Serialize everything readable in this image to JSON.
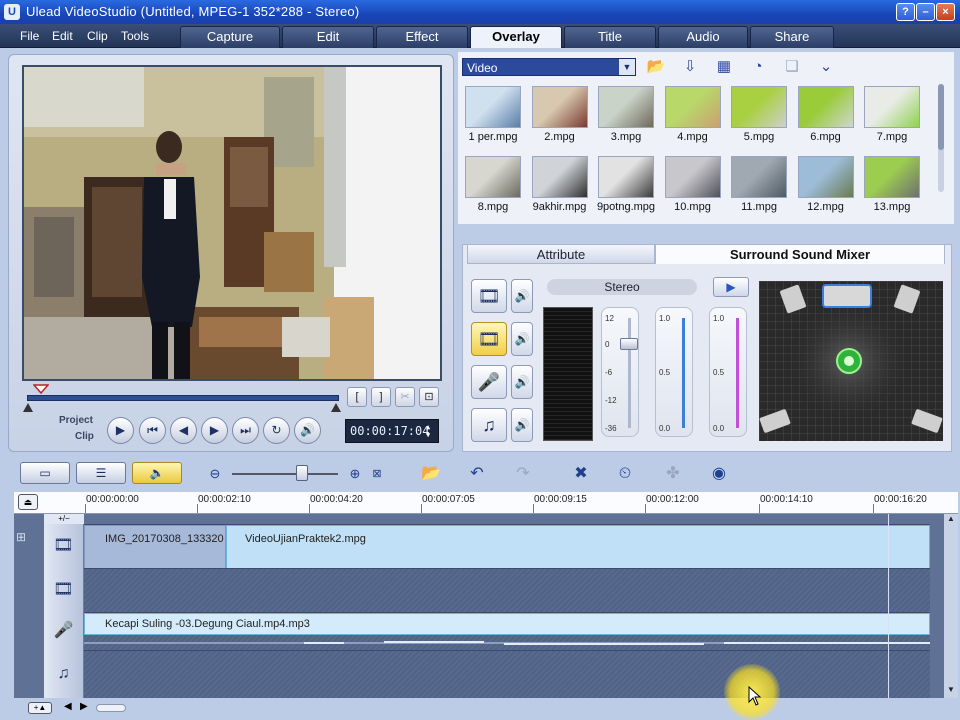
{
  "window": {
    "title": "Ulead VideoStudio (Untitled, MPEG-1 352*288 - Stereo)",
    "help_label": "?",
    "minimize_label": "–",
    "maximize_label": "□",
    "close_label": "×"
  },
  "menu": {
    "items": [
      "File",
      "Edit",
      "Clip",
      "Tools"
    ]
  },
  "steps": {
    "tabs": [
      "Capture",
      "Edit",
      "Effect",
      "Overlay",
      "Title",
      "Audio",
      "Share"
    ],
    "active": "Overlay"
  },
  "preview": {
    "project_label": "Project",
    "clip_label": "Clip",
    "timecode": "00:00:17:04",
    "mark_in_label": "[",
    "mark_out_label": "]"
  },
  "library": {
    "category": "Video",
    "items": [
      "1 per.mpg",
      "2.mpg",
      "3.mpg",
      "4.mpg",
      "5.mpg",
      "6.mpg",
      "7.mpg",
      "8.mpg",
      "9akhir.mpg",
      "9potng.mpg",
      "10.mpg",
      "11.mpg",
      "12.mpg",
      "13.mpg"
    ]
  },
  "options": {
    "tab_attribute": "Attribute",
    "tab_mixer": "Surround Sound Mixer",
    "stereo_label": "Stereo",
    "fader1_scale": [
      "12",
      "0",
      "-6",
      "-12",
      "-36"
    ],
    "fader2_scale": [
      "1.0",
      "0.5",
      "0.0"
    ],
    "fader3_scale": [
      "1.0",
      "0.5",
      "0.0"
    ]
  },
  "timeline": {
    "ruler": [
      "00:00:00:00",
      "00:00:02:10",
      "00:00:04:20",
      "00:00:07:05",
      "00:00:09:15",
      "00:00:12:00",
      "00:00:14:10",
      "00:00:16:20"
    ],
    "video_clip_1": "IMG_20170308_133320",
    "video_clip_2": "VideoUjianPraktek2.mpg",
    "audio_clip": "Kecapi Suling -03.Degung Ciaul.mp4.mp3",
    "zoom_label": "+/−"
  },
  "colors": {
    "accent": "#2c4a9c",
    "active_tab": "#eef2fb",
    "clip": "#bfe0f6",
    "selected": "#f0cf48"
  }
}
